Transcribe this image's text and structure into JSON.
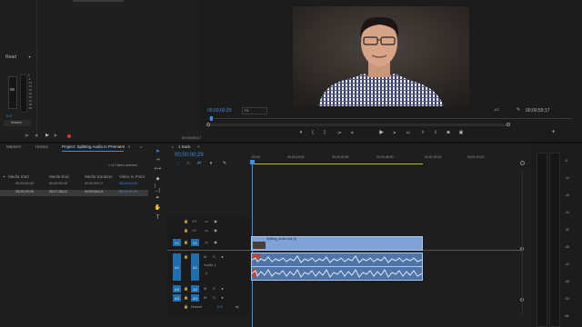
{
  "source_panel": {
    "label_read": "Read",
    "label_master": "Master",
    "meter_values": [
      "0",
      "-6",
      "-12",
      "-18",
      "-24",
      "-30",
      "-36",
      "-42",
      "-48",
      "-54"
    ],
    "timecode": "00;00;59;17"
  },
  "program_monitor": {
    "timecode_current": "00;00;00;29",
    "fit_label": "Fit",
    "fraction": "1/2",
    "timecode_duration": "00;00;59;17"
  },
  "project_panel": {
    "tabs": [
      "Markers",
      "History",
      "Project: Splitting Audio in Premiere"
    ],
    "items_selected": "1 of 2 items selected",
    "columns": [
      "Media Start",
      "Media End",
      "Media Duration",
      "Video In Point"
    ],
    "rows": [
      [
        "00;00;00;00",
        "00;00;59;16",
        "00;00;59;17",
        "00;00;00;00"
      ],
      [
        "05;26;39;26",
        "05;27;38;12",
        "00;00;58;14",
        "05;26;39;26"
      ]
    ]
  },
  "timeline": {
    "sequence_name": "1 track",
    "timecode": "00;00;00;29",
    "ruler_labels": [
      ":00;00",
      "00;00;16;00",
      "00;00;32;00",
      "00;00;48;00",
      "00;01;04;02",
      "00;01;20;02"
    ],
    "tracks": [
      {
        "name": "V3",
        "src": ""
      },
      {
        "name": "V2",
        "src": ""
      },
      {
        "name": "V1",
        "src": "V1"
      },
      {
        "name": "A1",
        "src": "A1"
      },
      {
        "name": "A2",
        "src": "A2"
      },
      {
        "name": "A3",
        "src": "A3"
      }
    ],
    "audio1_label": "Audio 1",
    "master_label": "Master",
    "master_value": "0.0",
    "video_clip_label": "Splitting_Audio.mp4 [V]",
    "audio_clip_label": "Splitting_Audio.mp4"
  },
  "audio_meter": {
    "values": [
      "-6",
      "-12",
      "-18",
      "-24",
      "-30",
      "-36",
      "-42",
      "-48",
      "-54",
      "dB"
    ]
  },
  "colors": {
    "accent_blue": "#3a8fe6",
    "clip_video": "#7fa3d6",
    "clip_audio": "#4f74a8",
    "track_button": "#1f6fb0"
  }
}
